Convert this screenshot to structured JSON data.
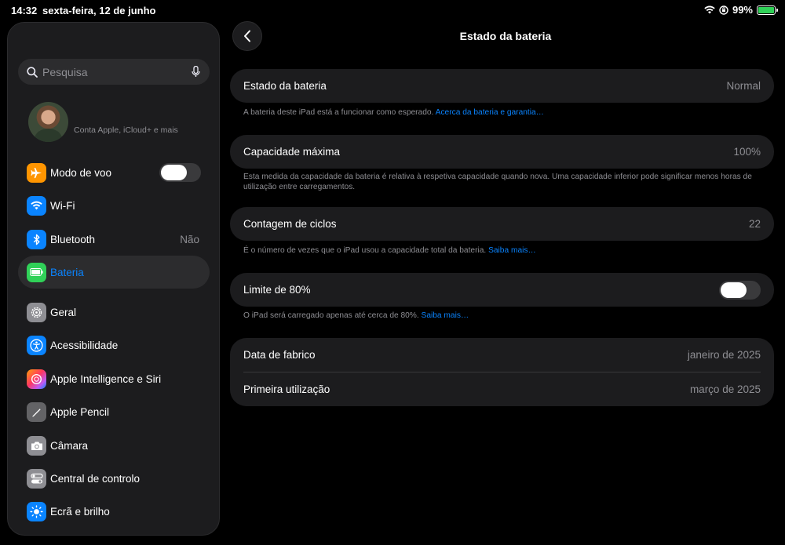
{
  "status": {
    "time": "14:32",
    "date": "sexta-feira, 12 de junho",
    "battery_percent": "99%"
  },
  "sidebar": {
    "search_placeholder": "Pesquisa",
    "account_subtitle": "Conta Apple, iCloud+ e mais",
    "items": [
      {
        "label": "Modo de voo",
        "icon": "airplane-icon",
        "color": "#ff9500",
        "toggle": false
      },
      {
        "label": "Wi-Fi",
        "icon": "wifi-icon",
        "color": "#0a84ff"
      },
      {
        "label": "Bluetooth",
        "icon": "bluetooth-icon",
        "color": "#0a84ff",
        "value": "Não"
      },
      {
        "label": "Bateria",
        "icon": "battery-icon",
        "color": "#30d158",
        "selected": true
      },
      {
        "label": "Geral",
        "icon": "gear-icon",
        "color": "#8e8e93"
      },
      {
        "label": "Acessibilidade",
        "icon": "accessibility-icon",
        "color": "#0a84ff"
      },
      {
        "label": "Apple Intelligence e Siri",
        "icon": "siri-icon",
        "color": "#bf5af2"
      },
      {
        "label": "Apple Pencil",
        "icon": "pencil-icon",
        "color": "#636366"
      },
      {
        "label": "Câmara",
        "icon": "camera-icon",
        "color": "#8e8e93"
      },
      {
        "label": "Central de controlo",
        "icon": "switches-icon",
        "color": "#8e8e93"
      },
      {
        "label": "Ecrã e brilho",
        "icon": "sun-icon",
        "color": "#0a84ff"
      }
    ]
  },
  "main": {
    "title": "Estado da bateria",
    "state": {
      "label": "Estado da bateria",
      "value": "Normal"
    },
    "state_note": "A bateria deste iPad está a funcionar como esperado.",
    "state_link": "Acerca da bateria e garantia…",
    "capacity": {
      "label": "Capacidade máxima",
      "value": "100%"
    },
    "capacity_note": "Esta medida da capacidade da bateria é relativa à respetiva capacidade quando nova. Uma capacidade inferior pode significar menos horas de utilização entre carregamentos.",
    "cycles": {
      "label": "Contagem de ciclos",
      "value": "22"
    },
    "cycles_note": "É o número de vezes que o iPad usou a capacidade total da bateria.",
    "cycles_link": "Saiba mais…",
    "limit": {
      "label": "Limite de 80%",
      "toggle": false
    },
    "limit_note": "O iPad será carregado apenas até cerca de 80%.",
    "limit_link": "Saiba mais…",
    "manufacture": {
      "label": "Data de fabrico",
      "value": "janeiro de 2025"
    },
    "first_use": {
      "label": "Primeira utilização",
      "value": "março de 2025"
    }
  }
}
